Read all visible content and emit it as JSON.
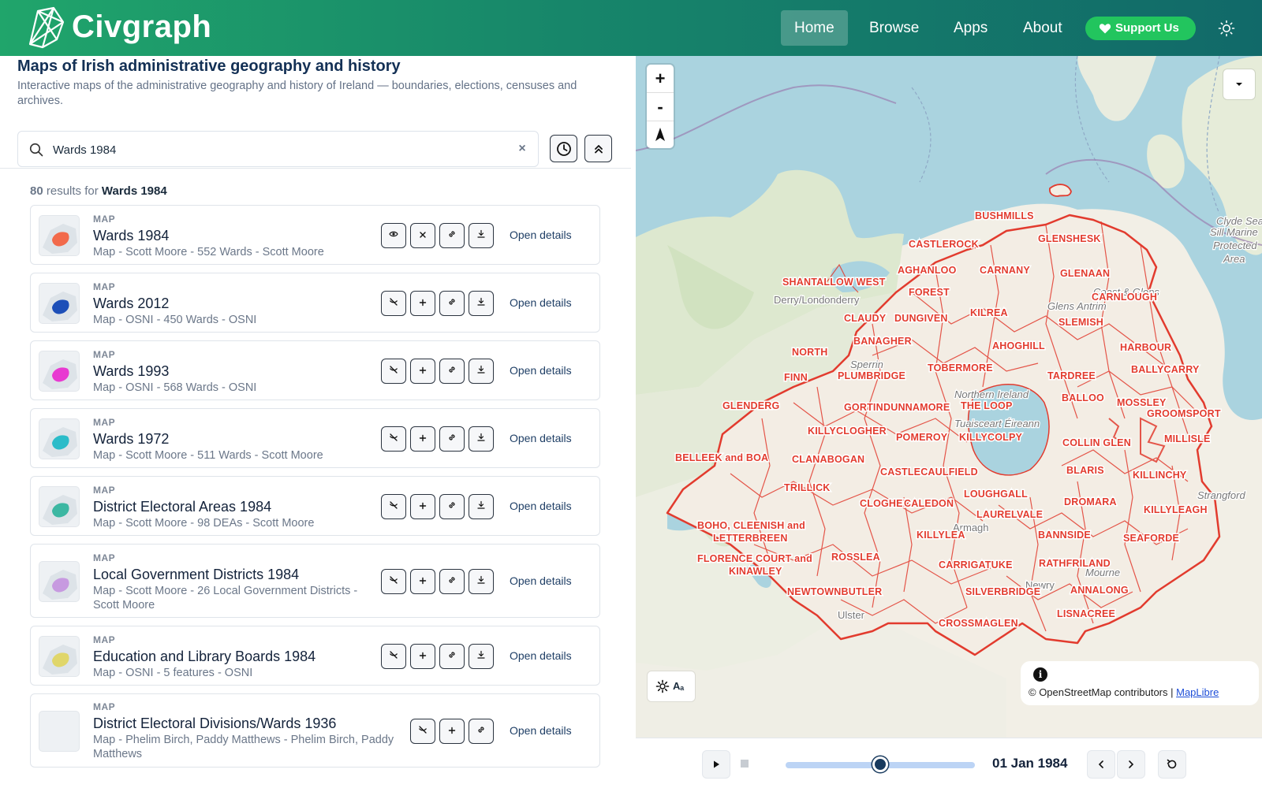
{
  "header": {
    "brand": "Civgraph",
    "nav": [
      "Home",
      "Browse",
      "Apps",
      "About"
    ],
    "active_nav": "Home",
    "support_label": "Support Us",
    "colors": {
      "gradient_start": "#20a56b",
      "gradient_end": "#116969",
      "support": "#22c55e"
    }
  },
  "page": {
    "title": "Maps of Irish administrative geography and history",
    "description": "Interactive maps of the administrative geography and history of Ireland — boundaries, elections, censuses and archives."
  },
  "search": {
    "value": "Wards 1984",
    "placeholder": ""
  },
  "results": {
    "count": "80",
    "label_mid": " results for ",
    "query": "Wards 1984",
    "open_label": "Open details",
    "items": [
      {
        "kind": "MAP",
        "title": "Wards 1984",
        "subtitle": "Map - Scott Moore - 552 Wards - Scott Moore",
        "color": "#f26a4b",
        "active": true
      },
      {
        "kind": "MAP",
        "title": "Wards 2012",
        "subtitle": "Map - OSNI - 450 Wards - OSNI",
        "color": "#1d4fb8",
        "active": false
      },
      {
        "kind": "MAP",
        "title": "Wards 1993",
        "subtitle": "Map - OSNI - 568 Wards - OSNI",
        "color": "#e83ad1",
        "active": false
      },
      {
        "kind": "MAP",
        "title": "Wards 1972",
        "subtitle": "Map - Scott Moore - 511 Wards - Scott Moore",
        "color": "#2bbcc9",
        "active": false
      },
      {
        "kind": "MAP",
        "title": "District Electoral Areas 1984",
        "subtitle": "Map - Scott Moore - 98 DEAs - Scott Moore",
        "color": "#3cb7a2",
        "active": false
      },
      {
        "kind": "MAP",
        "title": "Local Government Districts 1984",
        "subtitle": "Map - Scott Moore - 26 Local Government Districts - Scott Moore",
        "color": "#c79ae0",
        "active": false
      },
      {
        "kind": "MAP",
        "title": "Education and Library Boards 1984",
        "subtitle": "Map - OSNI - 5 features - OSNI",
        "color": "#e0d66a",
        "active": false
      },
      {
        "kind": "MAP",
        "title": "District Electoral Divisions/Wards 1936",
        "subtitle": "Map - Phelim Birch, Paddy Matthews - Phelim Birch, Paddy Matthews",
        "color": "",
        "active": false
      }
    ]
  },
  "map": {
    "zoom_in": "+",
    "zoom_out": "-",
    "settings_label": "Aₐ",
    "attribution_text": "© OpenStreetMap contributors | ",
    "attribution_link": "MapLibre",
    "ward_color": "#e23b2e",
    "water_color": "#aad3df",
    "land_color": "#f2efe6",
    "place_names": [
      "Derry/Londonderry",
      "Sperrin",
      "Northern Ireland",
      "Tuaisceart Éireann",
      "Armagh",
      "Ulster",
      "Glens Antrim",
      "Strangford",
      "Mourne",
      "Coast & Glens",
      "Newry"
    ],
    "sea_label": [
      "Clyde Sea",
      "Sill Marine",
      "Protected",
      "Area"
    ],
    "ward_labels": [
      "BUSHMILLS",
      "GLENSHESK",
      "CASTLEROCK",
      "AGHANLOO",
      "CARNANY",
      "GLENAAN",
      "SHANTALLOW WEST",
      "FOREST",
      "CARNLOUGH",
      "CLAUDY",
      "DUNGIVEN",
      "KILREA",
      "SLEMISH",
      "BANAGHER",
      "AHOGHILL",
      "HARBOUR",
      "NORTH",
      "TOBERMORE",
      "BALLYCARRY",
      "FINN",
      "PLUMBRIDGE",
      "TARDREE",
      "GLENDERG",
      "GORTIN",
      "DUNNAMORE",
      "THE LOOP",
      "BALLOO",
      "MOSSLEY",
      "GROOMSPORT",
      "KILLYCLOGHER",
      "POMEROY",
      "KILLYCOLPY",
      "COLLIN GLEN",
      "MILLISLE",
      "BELLEEK and BOA",
      "CLANABOGAN",
      "CASTLECAULFIELD",
      "BLARIS",
      "KILLINCHY",
      "TRILLICK",
      "CLOGHER",
      "CALEDON",
      "LOUGHGALL",
      "DROMARA",
      "KILLYLEAGH",
      "BOHO, CLEENISH and",
      "LETTERBREEN",
      "LAURELVALE",
      "KILLYLEA",
      "BANNSIDE",
      "SEAFORDE",
      "FLORENCE COURT and",
      "KINAWLEY",
      "ROSSLEA",
      "CARRIGATUKE",
      "RATHFRILAND",
      "NEWTOWNBUTLER",
      "SILVERBRIDGE",
      "ANNALONG",
      "LISNACREE",
      "CROSSMAGLEN"
    ]
  },
  "timeline": {
    "date": "01 Jan 1984",
    "progress": 0.5
  }
}
